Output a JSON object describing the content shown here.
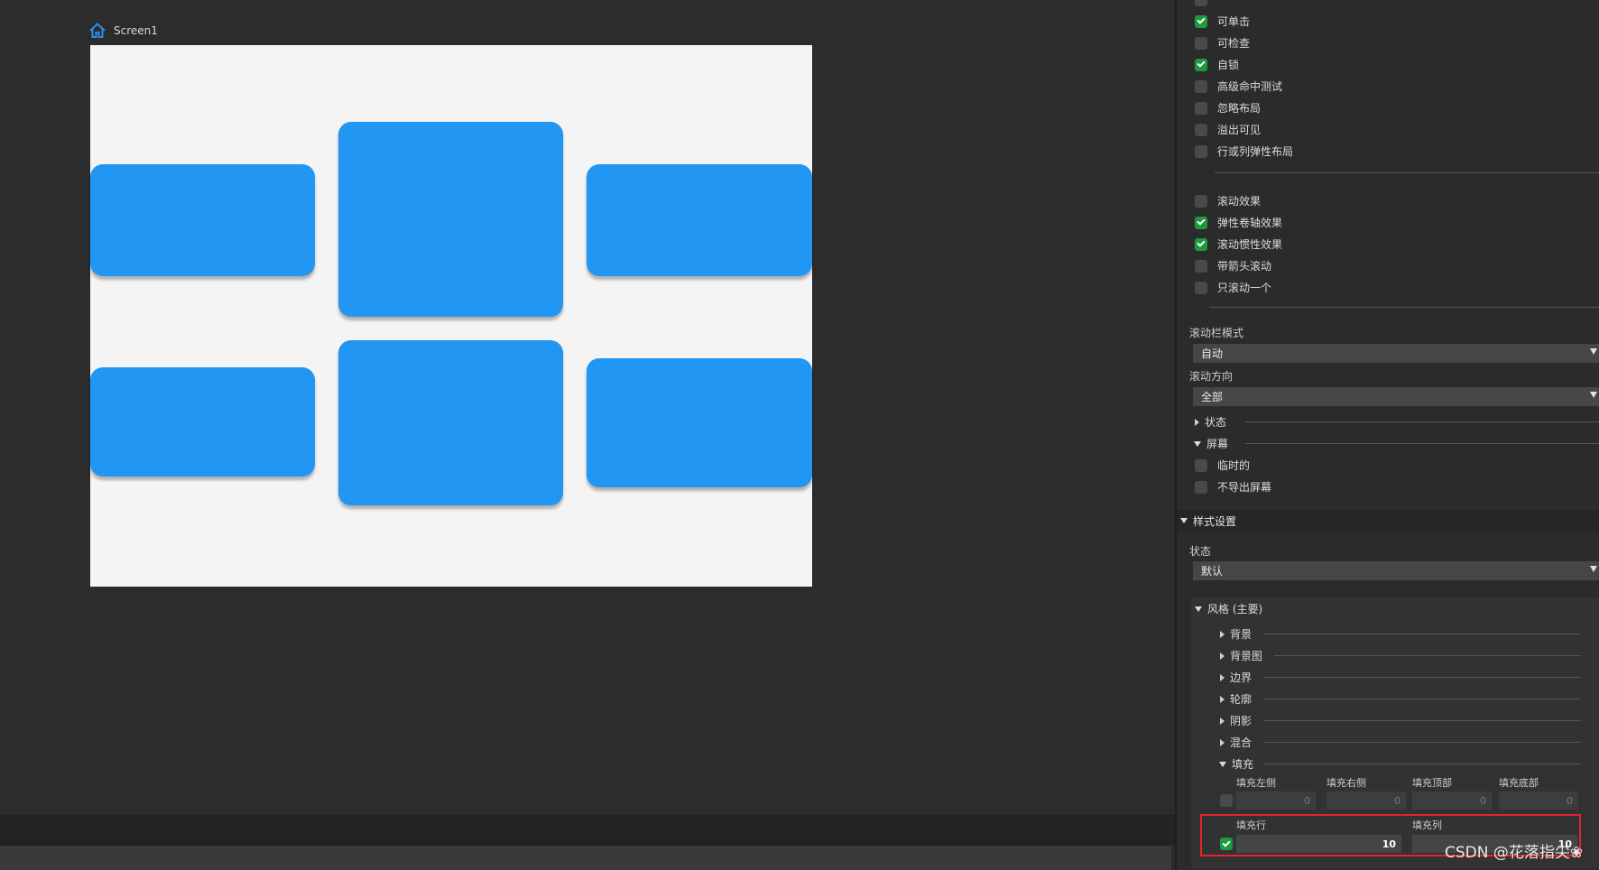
{
  "canvas": {
    "screen_name": "Screen1"
  },
  "panel": {
    "flags": [
      {
        "label": "可单击",
        "checked": true
      },
      {
        "label": "可检查",
        "checked": false
      },
      {
        "label": "自锁",
        "checked": true
      },
      {
        "label": "高级命中测试",
        "checked": false
      },
      {
        "label": "忽略布局",
        "checked": false
      },
      {
        "label": "溢出可见",
        "checked": false
      },
      {
        "label": "行或列弹性布局",
        "checked": false
      }
    ],
    "scroll_flags": [
      {
        "label": "滚动效果",
        "checked": false
      },
      {
        "label": "弹性卷轴效果",
        "checked": true
      },
      {
        "label": "滚动惯性效果",
        "checked": true
      },
      {
        "label": "带箭头滚动",
        "checked": false
      },
      {
        "label": "只滚动一个",
        "checked": false
      }
    ],
    "scrollbar_mode": {
      "label": "滚动栏模式",
      "value": "自动"
    },
    "scroll_direction": {
      "label": "滚动方向",
      "value": "全部"
    },
    "state_group": "状态",
    "screen_group": {
      "title": "屏幕",
      "items": [
        {
          "label": "临时的",
          "checked": false
        },
        {
          "label": "不导出屏幕",
          "checked": false
        }
      ]
    },
    "style_section": {
      "title": "样式设置",
      "state_label": "状态",
      "state_value": "默认",
      "style_group": "风格 (主要)",
      "subgroups": [
        "背景",
        "背景图",
        "边界",
        "轮廓",
        "阴影",
        "混合"
      ],
      "padding": {
        "title": "填充",
        "left_label": "填充左侧",
        "right_label": "填充右侧",
        "top_label": "填充顶部",
        "bottom_label": "填充底部",
        "left": "0",
        "right": "0",
        "top": "0",
        "bottom": "0",
        "row_label": "填充行",
        "col_label": "填充列",
        "row": "10",
        "col": "10",
        "rowcol_checked": true
      }
    }
  },
  "watermark": "CSDN @花落指尖❀"
}
